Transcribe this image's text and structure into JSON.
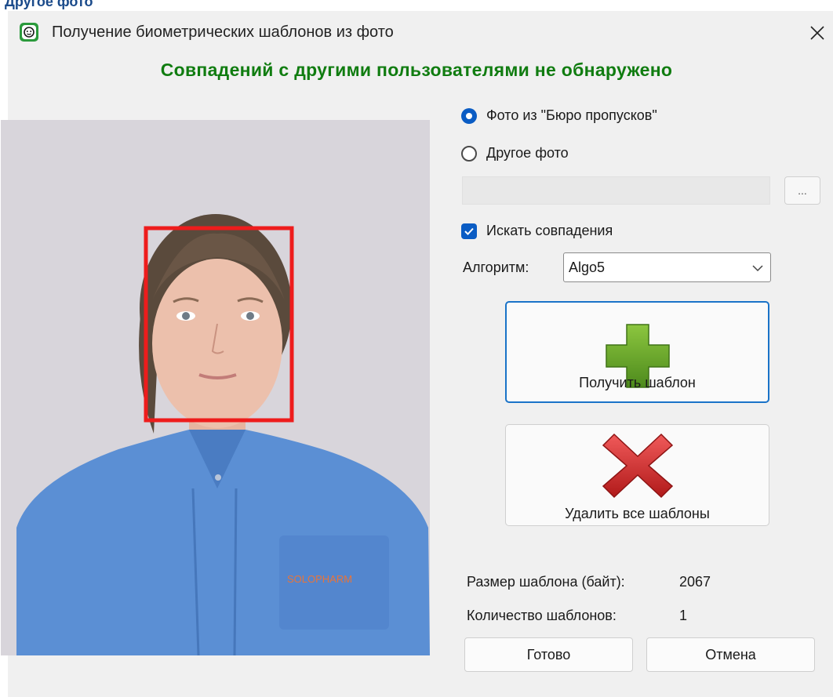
{
  "top_caption": "Другое фото",
  "window": {
    "title": "Получение биометрических шаблонов из фото",
    "close_glyph": "✕"
  },
  "heading": "Совпадений с другими пользователями не обнаружено",
  "heading_color": "#107c10",
  "photo": {
    "badge_text": "SOLOPHARM",
    "face_box_color": "#ee1c1c"
  },
  "source": {
    "options": [
      {
        "label": "Фото из \"Бюро пропусков\"",
        "checked": true
      },
      {
        "label": "Другое фото",
        "checked": false
      }
    ],
    "path_value": "",
    "browse_label": "..."
  },
  "search_matches": {
    "label": "Искать совпадения",
    "checked": true
  },
  "algorithm": {
    "label": "Алгоритм:",
    "value": "Algo5"
  },
  "actions": {
    "get_template": {
      "label": "Получить шаблон",
      "icon": "green-plus-icon"
    },
    "delete_templates": {
      "label": "Удалить все шаблоны",
      "icon": "red-x-icon"
    }
  },
  "stats": {
    "size_label": "Размер шаблона (байт):",
    "size_value": "2067",
    "count_label": "Количество шаблонов:",
    "count_value": "1"
  },
  "buttons": {
    "ok": "Готово",
    "cancel": "Отмена"
  },
  "colors": {
    "accent": "#0a5cc4",
    "focus_border": "#1a73c8"
  }
}
